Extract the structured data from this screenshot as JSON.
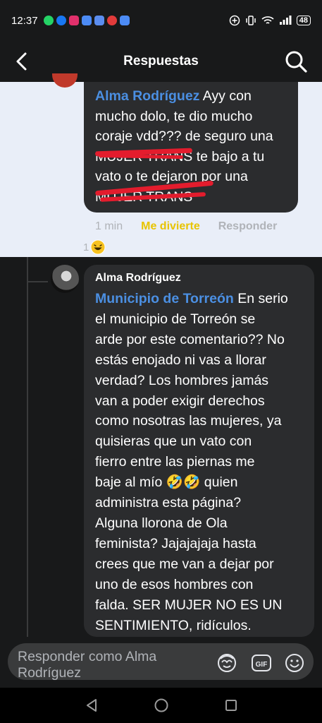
{
  "status_bar": {
    "time": "12:37",
    "battery": "48",
    "app_colors": [
      "#25d366",
      "#1877f2",
      "#e1306c",
      "#4c8bf5",
      "#5b8def",
      "#e23b3b",
      "#4c8bf5"
    ]
  },
  "header": {
    "title": "Respuestas"
  },
  "comment1": {
    "mention": "Alma Rodríguez",
    "lines": [
      " Ayy con",
      "mucho dolo, te dio mucho",
      "coraje vdd??? de seguro una",
      "MUJER TRANS te bajo a tu",
      "vato o te dejaron por una",
      "MUJER TRANS"
    ],
    "time": "1 min",
    "reaction_label": "Me divierte",
    "reply_label": "Responder",
    "reaction_count": "1"
  },
  "comment2": {
    "author": "Alma Rodríguez",
    "mention": "Municipio de Torreón",
    "first_line": " En serio",
    "lines": [
      "el municipio de Torreón se",
      "arde por este comentario?? No",
      "estás enojado ni vas a llorar",
      "verdad? Los hombres jamás",
      "van a poder exigir derechos",
      "como nosotras las mujeres, ya",
      "quisieras que un vato con",
      "fierro entre las piernas me",
      "baje al mío 🤣🤣 quien",
      "administra esta página?",
      "Alguna llorona de Ola",
      "feminista? Jajajajaja hasta",
      "crees que me van a dejar por",
      "uno de esos hombres con",
      "falda.  SER MUJER NO ES UN",
      "SENTIMIENTO, ridículos."
    ]
  },
  "composer": {
    "placeholder": "Responder como Alma Rodríguez"
  },
  "colors": {
    "mention": "#4b8fe2",
    "reaction": "#e8c400",
    "highlight_bg": "#e9eef8",
    "bubble_bg": "#2b2c2e",
    "strike": "#e31c2d"
  }
}
